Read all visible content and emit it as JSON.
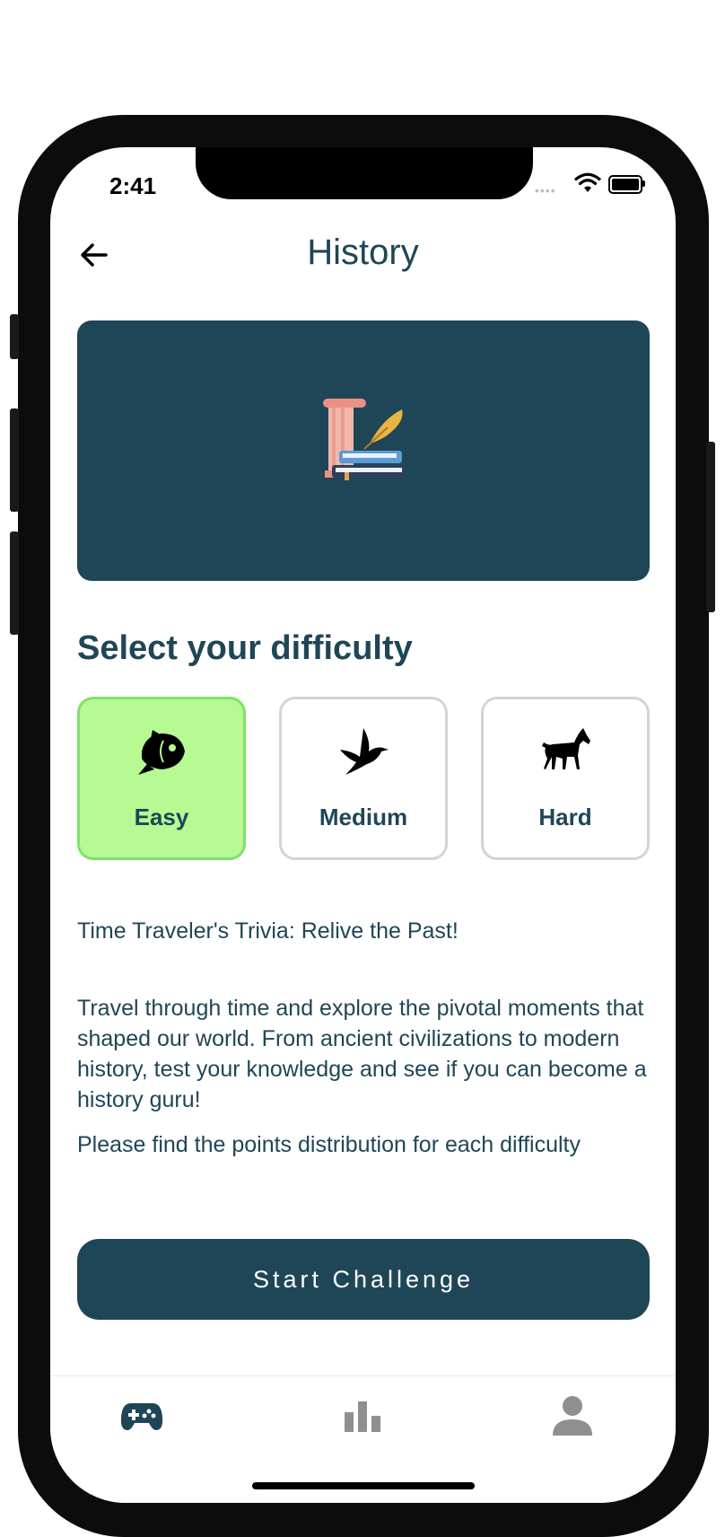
{
  "status_bar": {
    "time": "2:41",
    "signal": "••••"
  },
  "header": {
    "title": "History"
  },
  "difficulty": {
    "heading": "Select your difficulty",
    "options": [
      {
        "label": "Easy",
        "icon": "fish-icon",
        "selected": true
      },
      {
        "label": "Medium",
        "icon": "bird-icon",
        "selected": false
      },
      {
        "label": "Hard",
        "icon": "horse-icon",
        "selected": false
      }
    ]
  },
  "description": {
    "tagline": "Time Traveler's Trivia: Relive the Past!",
    "body": "Travel through time and explore the pivotal moments that shaped our world. From ancient civilizations to modern history, test your knowledge and see if you can become a history guru!",
    "points_note": "Please find the points distribution for each difficulty"
  },
  "cta": {
    "label": "Start Challenge"
  },
  "tab_bar": {
    "active": "games",
    "tabs": [
      "games",
      "leaderboard",
      "profile"
    ]
  },
  "colors": {
    "primary": "#1f4657",
    "selected_bg": "#b7f993",
    "selected_border": "#7de36a",
    "inactive_icon": "#8f8f8f"
  }
}
